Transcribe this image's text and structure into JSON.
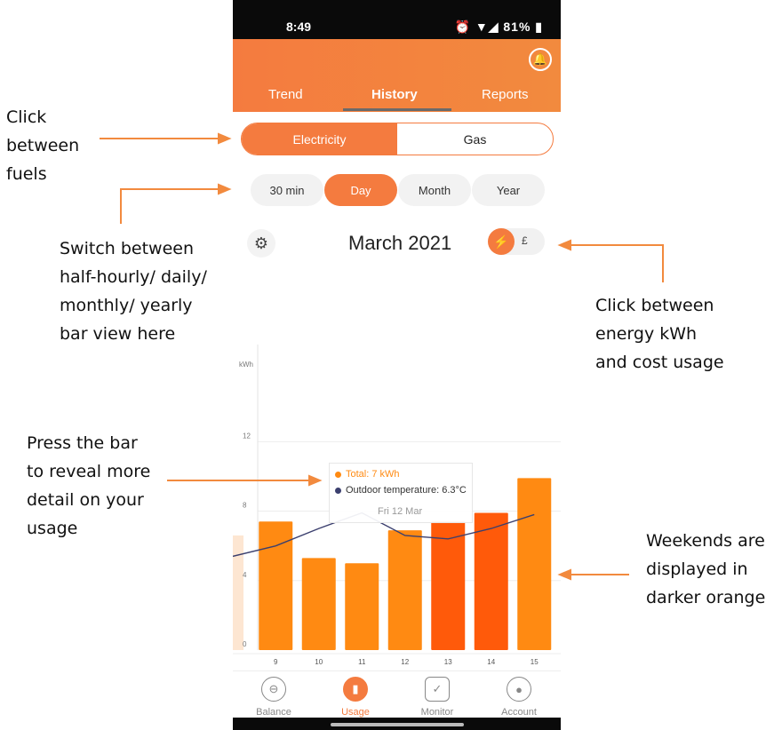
{
  "annotations": {
    "fuels": "Click\nbetween\nfuels",
    "period": "Switch between\nhalf-hourly/ daily/\nmonthly/ yearly\nbar view here",
    "energy_cost": "Click between\nenergy kWh\nand cost usage",
    "bar": "Press the bar\nto reveal more\ndetail on your\nusage",
    "weekends": "Weekends are\ndisplayed in\ndarker orange"
  },
  "status_bar": {
    "time": "8:49",
    "battery": "81%",
    "icons": "⏰ ▼◢ 81% ▮"
  },
  "header": {
    "tabs": [
      "Trend",
      "History",
      "Reports"
    ],
    "active_tab": "History",
    "bell_icon": "bell-icon"
  },
  "fuel_toggle": {
    "electricity": "Electricity",
    "gas": "Gas",
    "selected": "Electricity"
  },
  "periods": {
    "items": [
      "30 min",
      "Day",
      "Month",
      "Year"
    ],
    "selected": "Day"
  },
  "controls": {
    "month_label": "March 2021",
    "energy_icon": "lightning-icon",
    "cost_symbol": "£",
    "gear_icon": "gear-icon"
  },
  "chart_data": {
    "type": "bar",
    "ylabel": "kWh",
    "ylim": [
      0,
      18
    ],
    "yticks": [
      0,
      4,
      8,
      12
    ],
    "categories": [
      "9",
      "10",
      "11",
      "12",
      "13",
      "14",
      "15"
    ],
    "values": [
      7.4,
      5.3,
      5.0,
      6.9,
      7.4,
      7.9,
      9.9
    ],
    "weekend": [
      false,
      false,
      false,
      false,
      true,
      true,
      false
    ],
    "line_series": {
      "name": "Outdoor temperature",
      "values": [
        6.0,
        7.0,
        7.9,
        6.6,
        6.4,
        7.0,
        7.8
      ]
    },
    "colors": {
      "weekday": "#ff8a12",
      "weekend": "#ff5a0a",
      "line": "#3b3f6e"
    },
    "tooltip": {
      "total": "Total: 7 kWh",
      "temperature": "Outdoor temperature: 6.3°C",
      "date": "Fri 12 Mar"
    }
  },
  "bottom_nav": {
    "items": [
      {
        "label": "Balance",
        "icon": "balance-icon"
      },
      {
        "label": "Usage",
        "icon": "usage-icon"
      },
      {
        "label": "Monitor",
        "icon": "shield-check-icon"
      },
      {
        "label": "Account",
        "icon": "account-icon"
      }
    ],
    "selected": "Usage"
  },
  "accent": "#f47b3f"
}
